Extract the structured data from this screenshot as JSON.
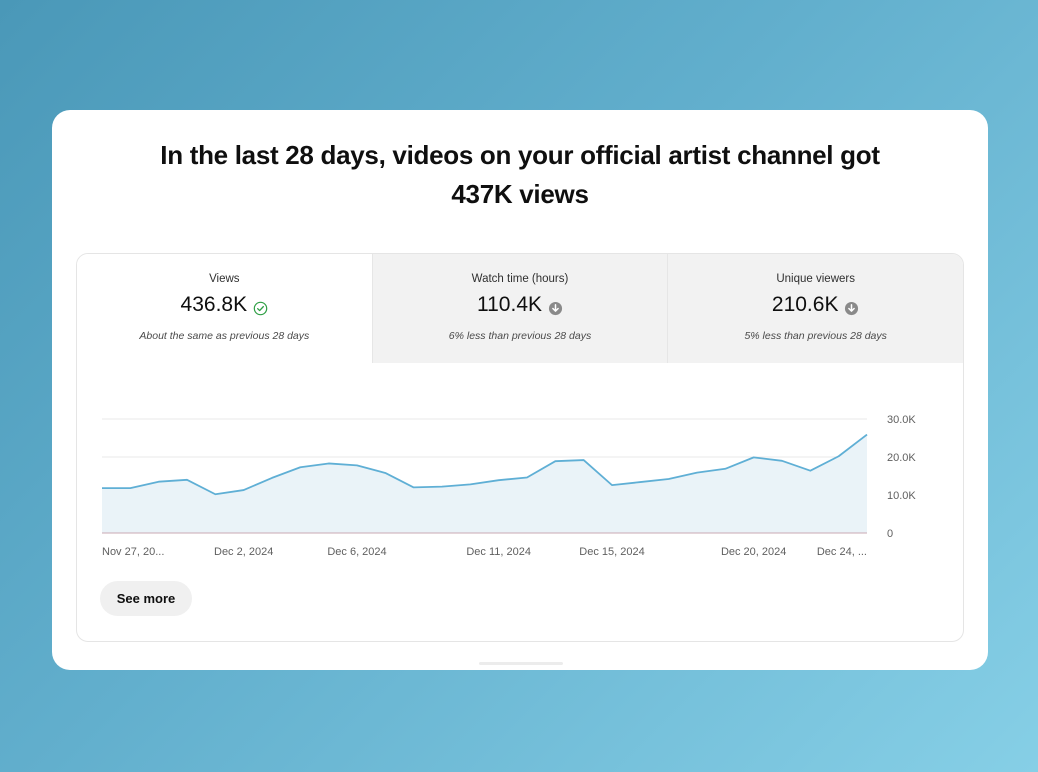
{
  "headline": {
    "line1": "In the last 28 days, videos on your official artist channel got",
    "line2": "437K views"
  },
  "tabs": [
    {
      "label": "Views",
      "value": "436.8K",
      "status_icon": "check-circle-icon",
      "note": "About the same as previous 28 days",
      "active": true
    },
    {
      "label": "Watch time (hours)",
      "value": "110.4K",
      "status_icon": "arrow-down-circle-icon",
      "note": "6% less than previous 28 days",
      "active": false
    },
    {
      "label": "Unique viewers",
      "value": "210.6K",
      "status_icon": "arrow-down-circle-icon",
      "note": "5% less than previous 28 days",
      "active": false
    }
  ],
  "colors": {
    "line": "#5fafd5",
    "fill": "#eaf3f8",
    "check": "#2e9e44",
    "down": "#8a8a8a"
  },
  "chart_data": {
    "type": "area",
    "x": [
      "Nov 27, 2024",
      "Nov 28, 2024",
      "Nov 29, 2024",
      "Nov 30, 2024",
      "Dec 1, 2024",
      "Dec 2, 2024",
      "Dec 3, 2024",
      "Dec 4, 2024",
      "Dec 5, 2024",
      "Dec 6, 2024",
      "Dec 7, 2024",
      "Dec 8, 2024",
      "Dec 9, 2024",
      "Dec 10, 2024",
      "Dec 11, 2024",
      "Dec 12, 2024",
      "Dec 13, 2024",
      "Dec 14, 2024",
      "Dec 15, 2024",
      "Dec 16, 2024",
      "Dec 17, 2024",
      "Dec 18, 2024",
      "Dec 19, 2024",
      "Dec 20, 2024",
      "Dec 21, 2024",
      "Dec 22, 2024",
      "Dec 23, 2024",
      "Dec 24, 2024"
    ],
    "values": [
      11800,
      11800,
      13500,
      14000,
      10200,
      11300,
      14500,
      17300,
      18300,
      17800,
      15800,
      12000,
      12200,
      12800,
      13900,
      14600,
      18900,
      19200,
      12600,
      13400,
      14200,
      15900,
      16900,
      19900,
      19000,
      16400,
      20200,
      25900
    ],
    "xtick_labels": [
      {
        "index": 0,
        "label": "Nov 27, 20..."
      },
      {
        "index": 5,
        "label": "Dec 2, 2024"
      },
      {
        "index": 9,
        "label": "Dec 6, 2024"
      },
      {
        "index": 14,
        "label": "Dec 11, 2024"
      },
      {
        "index": 18,
        "label": "Dec 15, 2024"
      },
      {
        "index": 23,
        "label": "Dec 20, 2024"
      },
      {
        "index": 27,
        "label": "Dec 24, ..."
      }
    ],
    "yticks": [
      0,
      10000,
      20000,
      30000
    ],
    "ytick_labels": [
      "0",
      "10.0K",
      "20.0K",
      "30.0K"
    ],
    "ylim": [
      0,
      30000
    ],
    "grid": true,
    "title": "",
    "xlabel": "",
    "ylabel": ""
  },
  "see_more_label": "See more"
}
